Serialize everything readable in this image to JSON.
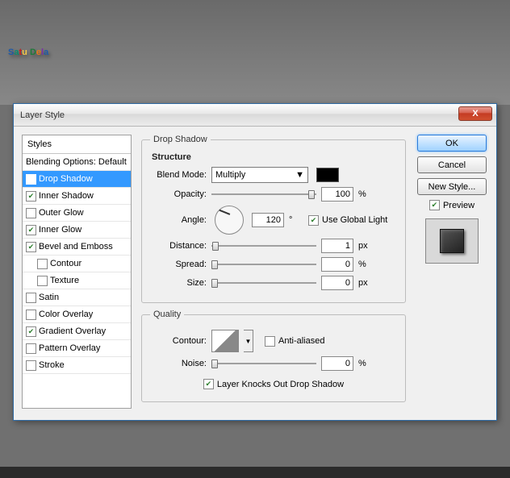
{
  "bg_letters": [
    "S",
    "a",
    "t",
    "u",
    " ",
    "D",
    "e",
    "l",
    "a"
  ],
  "dialog": {
    "title": "Layer Style",
    "close": "X",
    "styles_header": "Styles",
    "blending_options": "Blending Options: Default",
    "effects": [
      {
        "label": "Drop Shadow",
        "checked": true,
        "selected": true
      },
      {
        "label": "Inner Shadow",
        "checked": true
      },
      {
        "label": "Outer Glow",
        "checked": false
      },
      {
        "label": "Inner Glow",
        "checked": true
      },
      {
        "label": "Bevel and Emboss",
        "checked": true
      },
      {
        "label": "Contour",
        "checked": false,
        "indent": true
      },
      {
        "label": "Texture",
        "checked": false,
        "indent": true
      },
      {
        "label": "Satin",
        "checked": false
      },
      {
        "label": "Color Overlay",
        "checked": false
      },
      {
        "label": "Gradient Overlay",
        "checked": true
      },
      {
        "label": "Pattern Overlay",
        "checked": false
      },
      {
        "label": "Stroke",
        "checked": false
      }
    ],
    "panel_title": "Drop Shadow",
    "structure": {
      "heading": "Structure",
      "blend_mode_label": "Blend Mode:",
      "blend_mode_value": "Multiply",
      "opacity_label": "Opacity:",
      "opacity_value": "100",
      "pct": "%",
      "angle_label": "Angle:",
      "angle_value": "120",
      "deg": "°",
      "global_light": "Use Global Light",
      "distance_label": "Distance:",
      "distance_value": "1",
      "px": "px",
      "spread_label": "Spread:",
      "spread_value": "0",
      "size_label": "Size:",
      "size_value": "0"
    },
    "quality": {
      "heading": "Quality",
      "contour_label": "Contour:",
      "anti_aliased": "Anti-aliased",
      "noise_label": "Noise:",
      "noise_value": "0",
      "pct": "%",
      "knockout": "Layer Knocks Out Drop Shadow"
    },
    "buttons": {
      "ok": "OK",
      "cancel": "Cancel",
      "new_style": "New Style...",
      "preview": "Preview"
    }
  }
}
